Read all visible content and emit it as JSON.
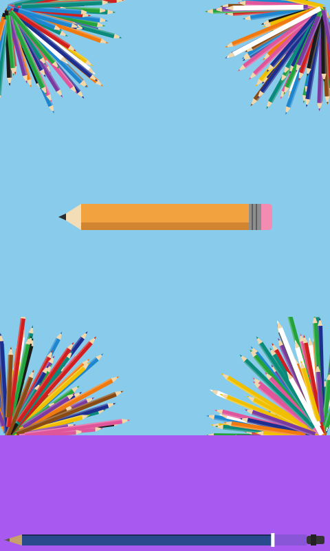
{
  "scene": {
    "background_color": "#88cbea",
    "panel_color": "#a85af0",
    "hero_pencil": {
      "name": "pencil-icon",
      "body_color": "#f2a23f",
      "stripe_color": "#d28531",
      "ferrule_color": "#8e8e8e",
      "eraser_color": "#f48bb2",
      "wood_color": "#f3ddb6",
      "lead_color": "#2b2b2b"
    },
    "corner_palette": [
      "#d11f1f",
      "#1c2f8f",
      "#24a33c",
      "#f0c000",
      "#f07a10",
      "#1a1a1a",
      "#ffffff",
      "#7a3aa0",
      "#1e86cf",
      "#e0569b",
      "#8a4a14",
      "#0a8a7a"
    ]
  },
  "progress": {
    "fraction": 0.88,
    "fill_color": "#2a4a8e",
    "edge_color": "#1a2a55",
    "marker_color": "#ffffff",
    "tip_color": "#c8a06a",
    "cap_color": "#333333"
  }
}
